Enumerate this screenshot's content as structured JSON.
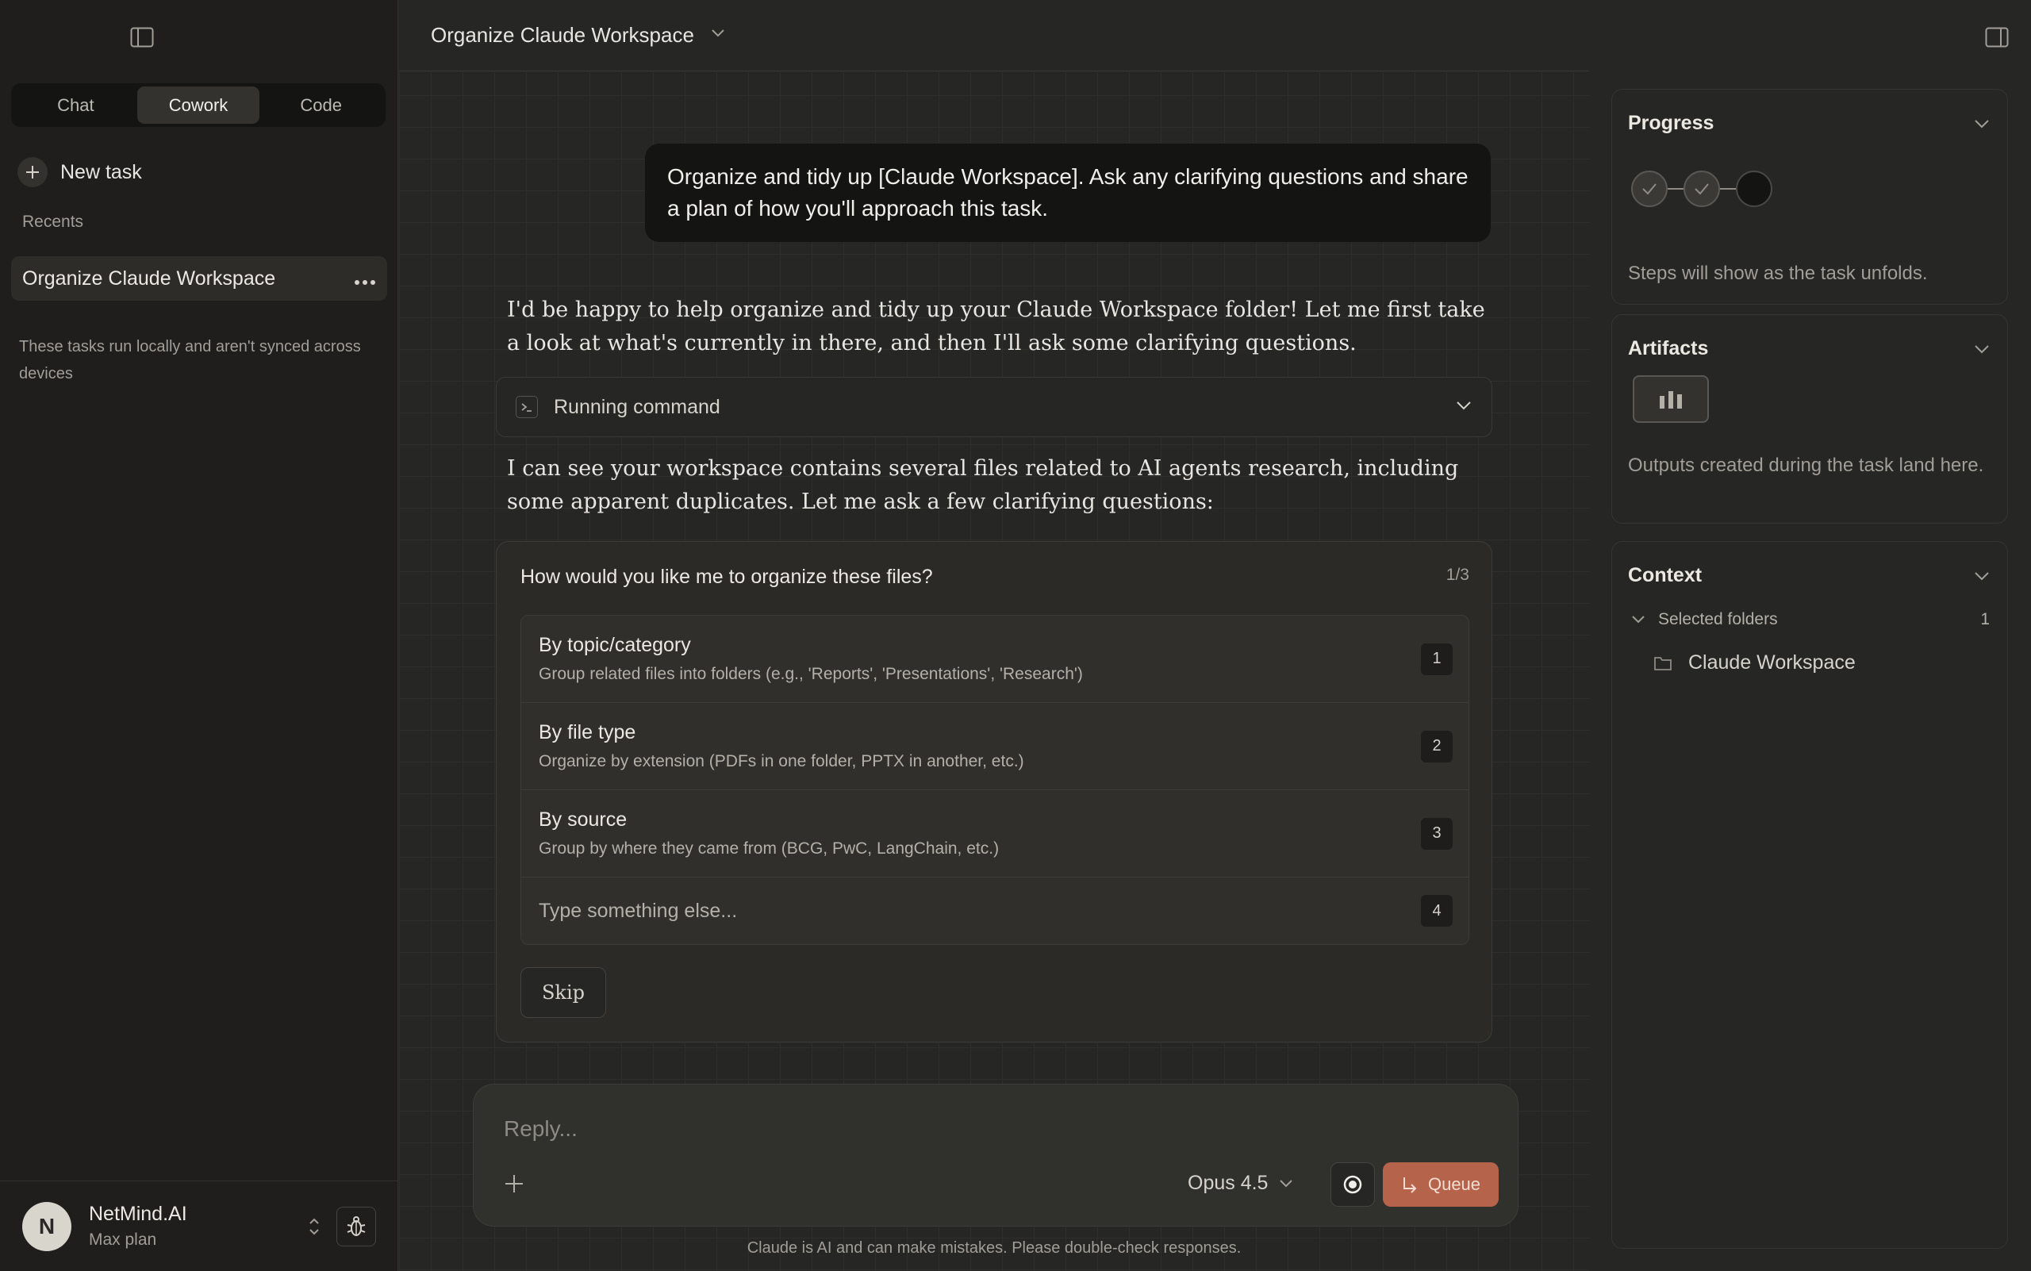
{
  "sidebar": {
    "tabs": [
      {
        "label": "Chat",
        "active": false
      },
      {
        "label": "Cowork",
        "active": true
      },
      {
        "label": "Code",
        "active": false
      }
    ],
    "new_task_label": "New task",
    "recents_heading": "Recents",
    "recents": [
      {
        "title": "Organize Claude Workspace"
      }
    ],
    "local_note": "These tasks run locally and aren't synced across devices",
    "user": {
      "initial": "N",
      "name": "NetMind.AI",
      "plan": "Max plan"
    }
  },
  "header": {
    "title": "Organize Claude Workspace"
  },
  "conversation": {
    "user_message": "Organize and tidy up [Claude Workspace].  Ask any clarifying questions and share a plan of how you'll approach this task.",
    "assistant_intro": "I'd be happy to help organize and tidy up your Claude Workspace folder! Let me first take a look at what's currently in there, and then I'll ask some clarifying questions.",
    "command_label": "Running command",
    "assistant_followup": "I can see your workspace contains several files related to AI agents research, including some apparent duplicates. Let me ask a few clarifying questions:",
    "question": {
      "text": "How would you like me to organize these files?",
      "counter": "1/3",
      "options": [
        {
          "title": "By topic/category",
          "description": "Group related files into folders (e.g., 'Reports', 'Presentations', 'Research')",
          "key": "1"
        },
        {
          "title": "By file type",
          "description": "Organize by extension (PDFs in one folder, PPTX in another, etc.)",
          "key": "2"
        },
        {
          "title": "By source",
          "description": "Group by where they came from (BCG, PwC, LangChain, etc.)",
          "key": "3"
        }
      ],
      "other_placeholder": "Type something else...",
      "other_key": "4",
      "skip_label": "Skip"
    }
  },
  "composer": {
    "placeholder": "Reply...",
    "model": "Opus 4.5",
    "queue_label": "Queue",
    "disclaimer": "Claude is AI and can make mistakes. Please double-check responses."
  },
  "right_panel": {
    "progress": {
      "title": "Progress",
      "description": "Steps will show as the task unfolds.",
      "steps": [
        "done",
        "done",
        "pending"
      ]
    },
    "artifacts": {
      "title": "Artifacts",
      "description": "Outputs created during the task land here."
    },
    "context": {
      "title": "Context",
      "selected_folders_label": "Selected folders",
      "selected_folders_count": "1",
      "folders": [
        "Claude Workspace"
      ]
    }
  },
  "colors": {
    "accent": "#b5634a",
    "background": "#262624",
    "sidebar": "#1f1e1d"
  },
  "icons": [
    "sidebar-toggle-icon",
    "plus-icon",
    "more-icon",
    "chevron-down-icon",
    "terminal-icon",
    "record-icon",
    "queue-arrow-icon",
    "bug-icon",
    "folder-icon",
    "chart-icon",
    "check-icon",
    "updown-icon",
    "panel-toggle-icon"
  ]
}
